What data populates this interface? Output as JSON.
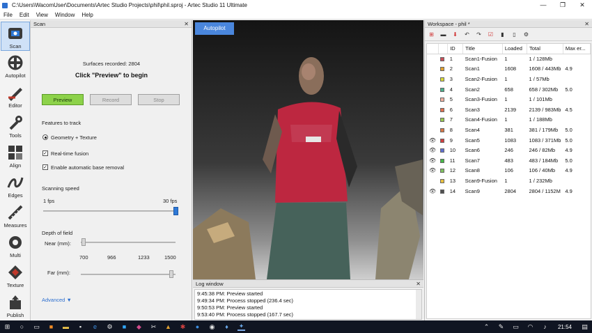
{
  "window": {
    "title": "C:\\Users\\WacomUser\\Documents\\Artec Studio Projects\\phil\\phil.sproj  -  Artec Studio 11 Ultimate",
    "minimize": "—",
    "maximize": "❐",
    "close": "✕"
  },
  "menu": [
    "File",
    "Edit",
    "View",
    "Window",
    "Help"
  ],
  "toolbar": {
    "tools": [
      {
        "label": "Scan",
        "icon": "camera-icon"
      },
      {
        "label": "Autopilot",
        "icon": "autopilot-icon"
      },
      {
        "label": "Editor",
        "icon": "editor-icon"
      },
      {
        "label": "Tools",
        "icon": "tools-icon"
      },
      {
        "label": "Align",
        "icon": "align-icon"
      },
      {
        "label": "Edges",
        "icon": "edges-icon"
      },
      {
        "label": "Measures",
        "icon": "measures-icon"
      },
      {
        "label": "Multi",
        "icon": "multi-icon"
      },
      {
        "label": "Texture",
        "icon": "texture-icon"
      },
      {
        "label": "Publish",
        "icon": "publish-icon"
      }
    ]
  },
  "scan_panel": {
    "title": "Scan",
    "close": "✕",
    "surfaces": "Surfaces recorded: 2804",
    "prompt": "Click \"Preview\" to begin",
    "buttons": {
      "preview": "Preview",
      "record": "Record",
      "stop": "Stop"
    },
    "features_label": "Features to track",
    "geometry_option": "Geometry + Texture",
    "realtime_fusion": "Real-time fusion",
    "auto_base_removal": "Enable automatic base removal",
    "speed_label": "Scanning speed",
    "speed_min": "1 fps",
    "speed_max": "30 fps",
    "speed_value_fraction": 1.0,
    "depth_label": "Depth of field",
    "near_label": "Near (mm):",
    "far_label": "Far (mm):",
    "depth_ticks": [
      "700",
      "966",
      "1233",
      "1500"
    ],
    "advanced": "Advanced"
  },
  "viewport": {
    "autopilot": "Autopilot"
  },
  "log": {
    "title": "Log window",
    "close": "✕",
    "lines": [
      "9:45:38 PM: Preview started",
      "9:49:34 PM: Process stopped (236.4 sec)",
      "9:50:53 PM: Preview started",
      "9:53:40 PM: Process stopped (167.7 sec)"
    ]
  },
  "workspace": {
    "title": "Workspace - phil *",
    "close": "✕",
    "columns": [
      "",
      "",
      "ID",
      "Title",
      "Loaded",
      "Total",
      "Max er..."
    ],
    "rows": [
      {
        "eye": "",
        "color": "#c8505a",
        "id": "1",
        "title": "Scan1-Fusion",
        "loaded": "1",
        "total": "1 / 128Mb",
        "maxerr": ""
      },
      {
        "eye": "",
        "color": "#e0a030",
        "id": "2",
        "title": "Scan1",
        "loaded": "1608",
        "total": "1608 / 443Mb",
        "maxerr": "4.9"
      },
      {
        "eye": "",
        "color": "#d8d838",
        "id": "3",
        "title": "Scan2-Fusion",
        "loaded": "1",
        "total": "1 / 57Mb",
        "maxerr": ""
      },
      {
        "eye": "",
        "color": "#4caf8c",
        "id": "4",
        "title": "Scan2",
        "loaded": "658",
        "total": "658 / 302Mb",
        "maxerr": "5.0"
      },
      {
        "eye": "",
        "color": "#f0b0a0",
        "id": "5",
        "title": "Scan3-Fusion",
        "loaded": "1",
        "total": "1 / 101Mb",
        "maxerr": ""
      },
      {
        "eye": "",
        "color": "#e07050",
        "id": "6",
        "title": "Scan3",
        "loaded": "2139",
        "total": "2139 / 983Mb",
        "maxerr": "4.5"
      },
      {
        "eye": "",
        "color": "#98c850",
        "id": "7",
        "title": "Scan4-Fusion",
        "loaded": "1",
        "total": "1 / 188Mb",
        "maxerr": ""
      },
      {
        "eye": "",
        "color": "#d87848",
        "id": "8",
        "title": "Scan4",
        "loaded": "381",
        "total": "381 / 179Mb",
        "maxerr": "5.0"
      },
      {
        "eye": "👁",
        "color": "#d04040",
        "id": "9",
        "title": "Scan5",
        "loaded": "1083",
        "total": "1083 / 371Mb",
        "maxerr": "5.0"
      },
      {
        "eye": "👁",
        "color": "#6070d0",
        "id": "10",
        "title": "Scan6",
        "loaded": "246",
        "total": "246 / 82Mb",
        "maxerr": "4.9"
      },
      {
        "eye": "👁",
        "color": "#48b848",
        "id": "11",
        "title": "Scan7",
        "loaded": "483",
        "total": "483 / 184Mb",
        "maxerr": "5.0"
      },
      {
        "eye": "👁",
        "color": "#80c060",
        "id": "12",
        "title": "Scan8",
        "loaded": "106",
        "total": "106 / 40Mb",
        "maxerr": "4.9"
      },
      {
        "eye": "",
        "color": "#e8c040",
        "id": "13",
        "title": "Scan9-Fusion",
        "loaded": "1",
        "total": "1 / 232Mb",
        "maxerr": ""
      },
      {
        "eye": "👁",
        "color": "#505050",
        "id": "14",
        "title": "Scan9",
        "loaded": "2804",
        "total": "2804 / 1152M",
        "maxerr": "4.9"
      }
    ]
  },
  "taskbar": {
    "clock": "21:54"
  }
}
